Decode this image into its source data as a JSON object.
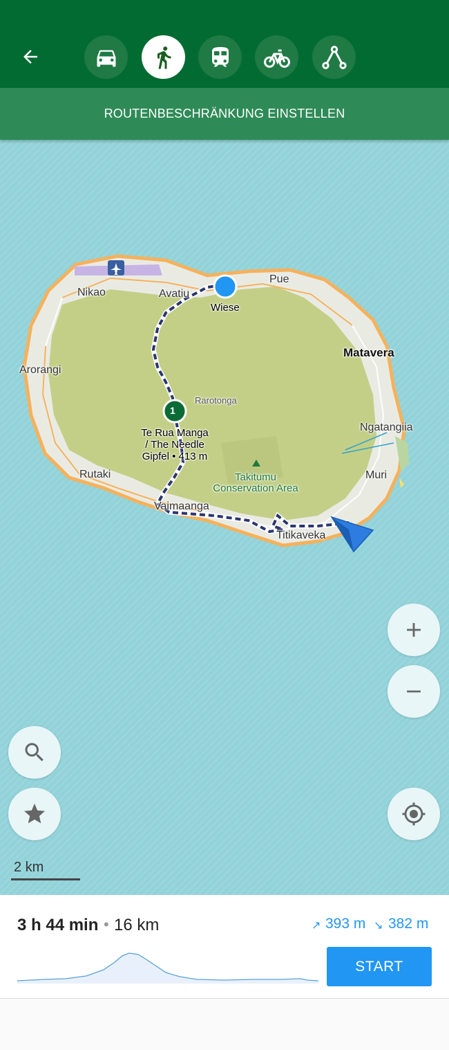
{
  "header": {
    "modes": [
      {
        "id": "car",
        "icon": "car-icon",
        "active": false
      },
      {
        "id": "walk",
        "icon": "pedestrian-icon",
        "active": true
      },
      {
        "id": "transit",
        "icon": "train-icon",
        "active": false
      },
      {
        "id": "bike",
        "icon": "bicycle-icon",
        "active": false
      },
      {
        "id": "route",
        "icon": "route-planner-icon",
        "active": false
      }
    ],
    "restriction_label": "ROUTENBESCHRÄNKUNG EINSTELLEN"
  },
  "map": {
    "places": {
      "nikao": "Nikao",
      "avatiu": "Avatiu",
      "pue": "Pue",
      "wiese": "Wiese",
      "matavera": "Matavera",
      "arorangi": "Arorangi",
      "rarotonga": "Rarotonga",
      "ngatangiia": "Ngatangiia",
      "muri": "Muri",
      "rutaki": "Rutaki",
      "vaimaanga": "Vaimaanga",
      "titikaveka": "Titikaveka",
      "takitumu_1": "Takitumu",
      "takitumu_2": "Conservation Area"
    },
    "waypoint": {
      "number": "1",
      "name_line1": "Te Rua Manga",
      "name_line2": "/ The Needle",
      "name_line3": "Gipfel • ⁠413 m"
    },
    "scale_label": "2 km"
  },
  "summary": {
    "duration": "3 h 44 min",
    "separator": "•",
    "distance": "16 km",
    "ascent": "393 m",
    "descent": "382 m",
    "ascent_arrow": "↗",
    "descent_arrow": "↘",
    "start_label": "START"
  },
  "colors": {
    "header": "#016b32",
    "restriction_bar": "#2e8b57",
    "water": "#92d2d9",
    "land": "#c3cf87",
    "accent": "#2196f3"
  }
}
